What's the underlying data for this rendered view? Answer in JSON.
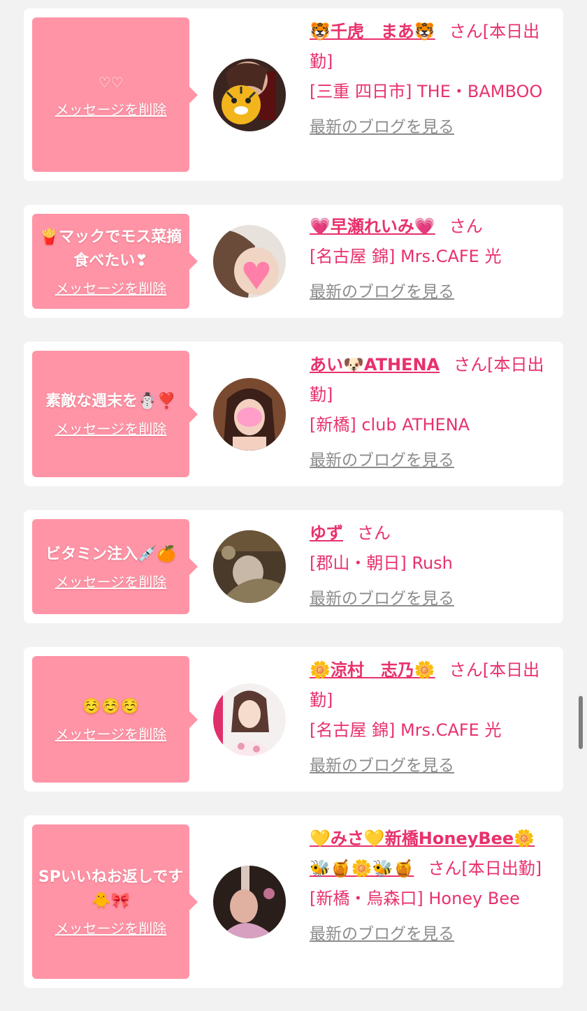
{
  "cards": [
    {
      "bubble_message": "♡♡",
      "delete_label": "メッセージを削除",
      "name": "🐯千虎　まあ🐯",
      "suffix": "さん[本日出勤]",
      "shop": "[三重 四日市] THE・BAMBOO",
      "blog_label": "最新のブログを見る",
      "avatar_icon": "tiger-emoji-sticker-photo"
    },
    {
      "bubble_message": "🍟マックでモス菜摘食べたい❣",
      "delete_label": "メッセージを削除",
      "name": "💗早瀬れいみ💗",
      "suffix": "さん",
      "shop": "[名古屋 錦] Mrs.CAFE 光",
      "blog_label": "最新のブログを見る",
      "avatar_icon": "heart-sticker-photo"
    },
    {
      "bubble_message": "素敵な週末を☃️❣️",
      "delete_label": "メッセージを削除",
      "name": "あい🐶ATHENA",
      "suffix": "さん[本日出勤]",
      "shop": "[新橋] club ATHENA",
      "blog_label": "最新のブログを見る",
      "avatar_icon": "pink-blur-photo"
    },
    {
      "bubble_message": "ビタミン注入💉🍊",
      "delete_label": "メッセージを削除",
      "name": "ゆず",
      "suffix": "さん",
      "shop": "[郡山・朝日] Rush",
      "blog_label": "最新のブログを見る",
      "avatar_icon": "photo"
    },
    {
      "bubble_message": "☺️☺️☺️",
      "delete_label": "メッセージを削除",
      "name": "🌼涼村　志乃🌼",
      "suffix": "さん[本日出勤]",
      "shop": "[名古屋 錦] Mrs.CAFE 光",
      "blog_label": "最新のブログを見る",
      "avatar_icon": "photo"
    },
    {
      "bubble_message": "SPいいねお返しです🐥🎀",
      "delete_label": "メッセージを削除",
      "name": "💛みさ💛新橋HoneyBee🌼🐝🍯🌼🐝🍯",
      "suffix": "さん[本日出勤]",
      "shop": "[新橋・烏森口] Honey Bee",
      "blog_label": "最新のブログを見る",
      "avatar_icon": "photo"
    }
  ]
}
